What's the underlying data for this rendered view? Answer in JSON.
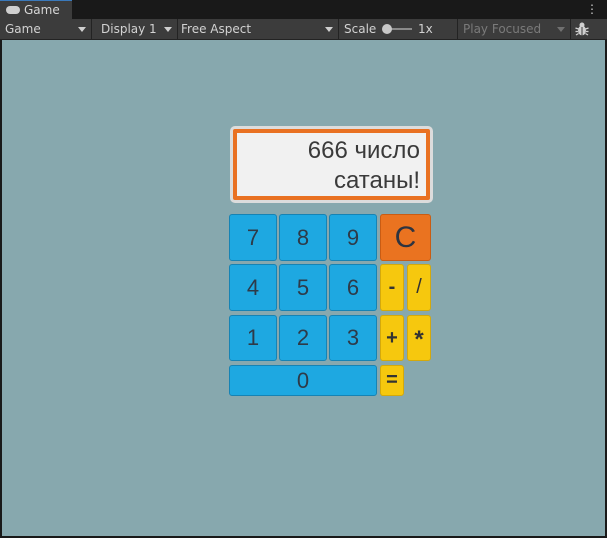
{
  "tab": {
    "label": "Game"
  },
  "toolbar": {
    "view_mode": "Game",
    "display": "Display 1",
    "aspect": "Free Aspect",
    "scale_label": "Scale",
    "scale_value": "1x",
    "play_mode": "Play Focused"
  },
  "calculator": {
    "display_line1": "666 число",
    "display_line2": "сатаны!",
    "keys": {
      "seven": "7",
      "eight": "8",
      "nine": "9",
      "clear": "C",
      "four": "4",
      "five": "5",
      "six": "6",
      "minus": "-",
      "divide": "/",
      "one": "1",
      "two": "2",
      "three": "3",
      "plus": "+",
      "multiply": "*",
      "zero": "0",
      "equals": "="
    }
  },
  "colors": {
    "game_background": "#87a8ae",
    "number_key": "#1ea8e1",
    "operator_key": "#f6c80e",
    "clear_key": "#ea7320",
    "display_border": "#e97122"
  },
  "icons": {
    "tab_icon": "gamepad-icon",
    "menu": "kebab-menu-icon",
    "debug": "bug-icon"
  }
}
